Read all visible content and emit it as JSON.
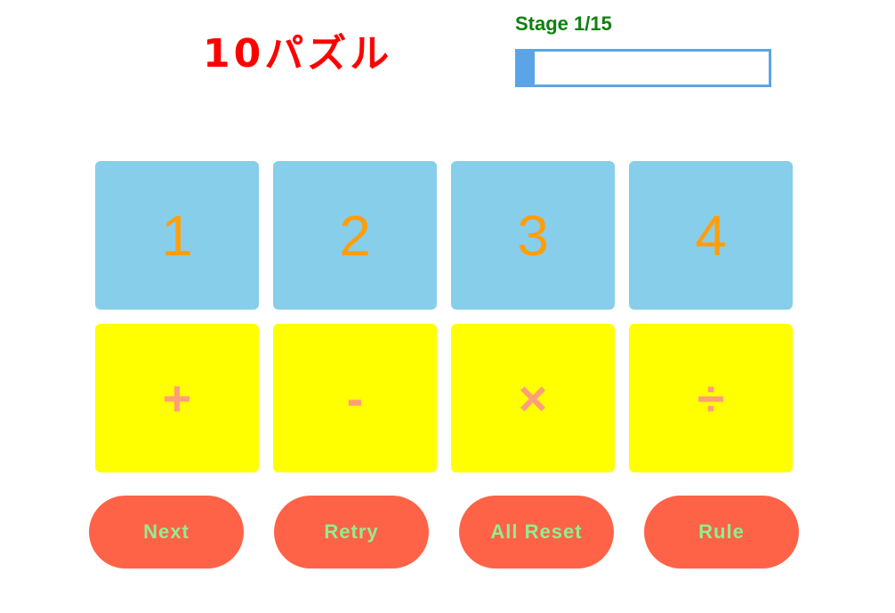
{
  "title": "10パズル",
  "stage": {
    "label": "Stage 1/15",
    "progress_fraction": 0.0667
  },
  "numbers": [
    "1",
    "2",
    "3",
    "4"
  ],
  "operators": [
    "+",
    "-",
    "×",
    "÷"
  ],
  "buttons": {
    "next": "Next",
    "retry": "Retry",
    "all_reset": "All Reset",
    "rule": "Rule"
  },
  "colors": {
    "title": "#ff0000",
    "stage_label": "#108010",
    "progress": "#5ba5e6",
    "number_tile": "#87ceeb",
    "number_text": "#ff9e0b",
    "operator_tile": "#ffff00",
    "operator_text": "#ff9e7b",
    "button_bg": "#ff6347",
    "button_text": "#90ee90"
  }
}
